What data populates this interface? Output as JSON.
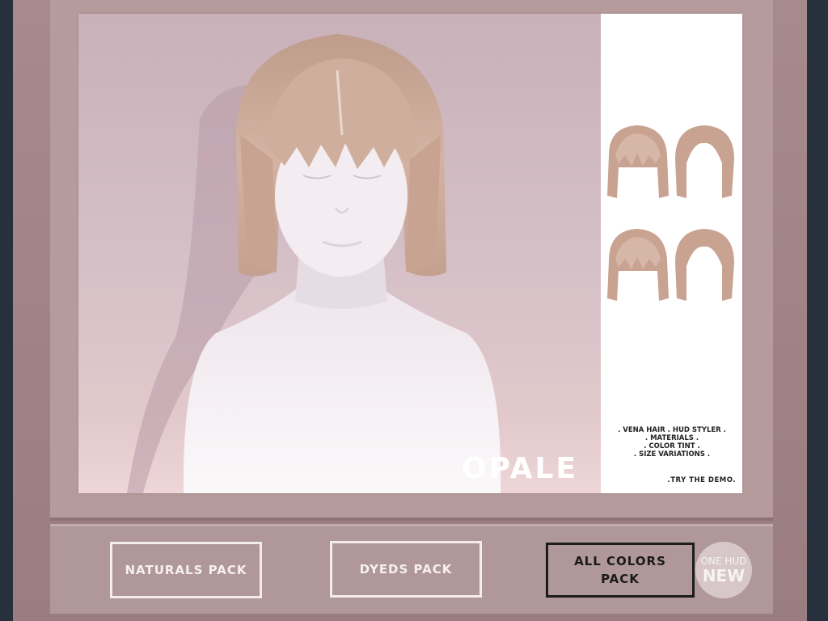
{
  "poster": {
    "brand": "OPALE",
    "features": [
      ". VENA HAIR . HUD STYLER .",
      ". MATERIALS .",
      ". COLOR TINT .",
      ". SIZE VARIATIONS ."
    ],
    "demo_note": ".TRY THE DEMO."
  },
  "buttons": {
    "naturals": "NATURALS PACK",
    "dyeds": "DYEDS PACK",
    "all_colors_line1": "ALL COLORS",
    "all_colors_line2": "PACK"
  },
  "badge": {
    "line1": "ONE HUD",
    "line2": "NEW"
  },
  "colors": {
    "frame": "#26313d",
    "wall": "#a88a8c",
    "backdrop": "#cdb5bd",
    "hair": "#c9a895",
    "skin": "#f4eef2"
  }
}
